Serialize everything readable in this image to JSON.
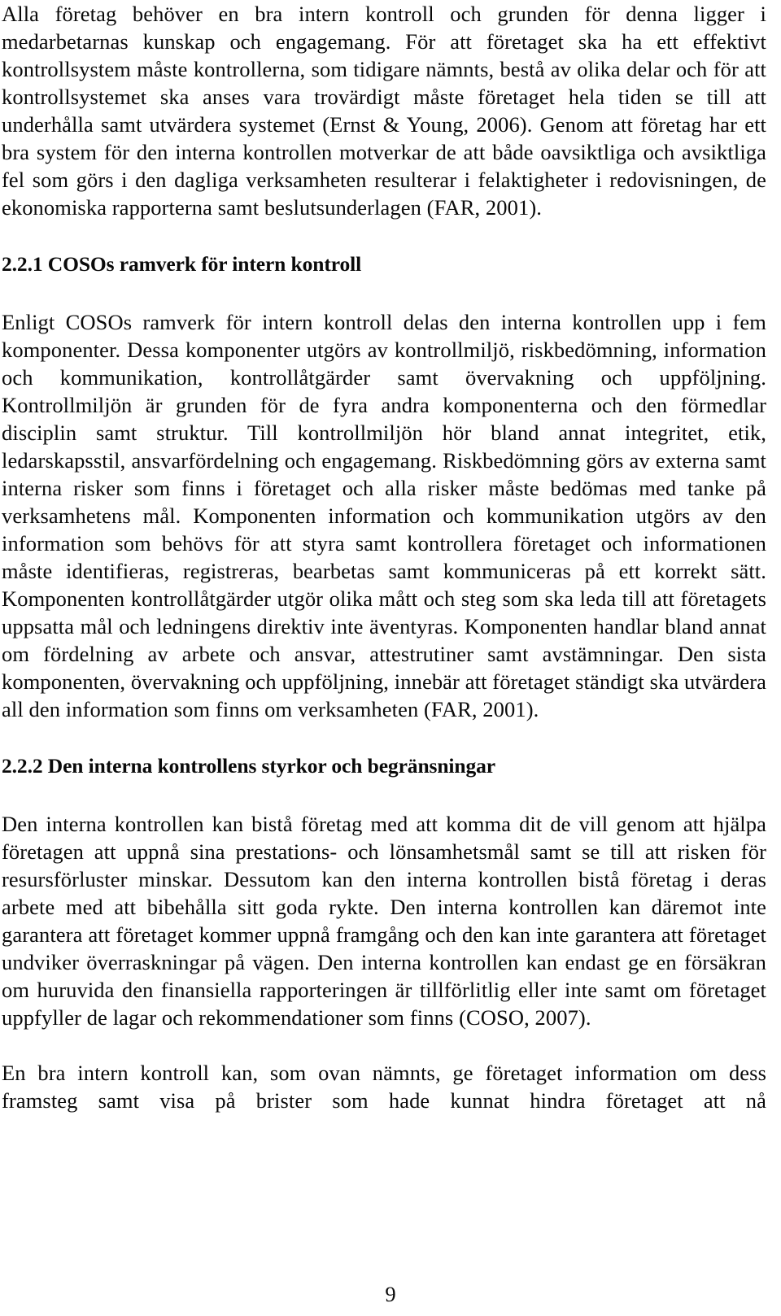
{
  "document": {
    "page_number": "9",
    "language": "sv",
    "blocks": [
      {
        "type": "paragraph",
        "name": "paragraph-intro-internal-control",
        "text": "Alla företag behöver en bra intern kontroll och grunden för denna ligger i medarbetarnas kunskap och engagemang. För att företaget ska ha ett effektivt kontrollsystem måste kontrollerna, som tidigare nämnts, bestå av olika delar och för att kontrollsystemet ska anses vara trovärdigt måste företaget hela tiden se till att underhålla samt utvärdera systemet (Ernst & Young, 2006). Genom att företag har ett bra system för den interna kontrollen motverkar de att både oavsiktliga och avsiktliga fel som görs i den dagliga verksamheten resulterar i felaktigheter i redovisningen, de ekonomiska rapporterna samt beslutsunderlagen (FAR, 2001)."
      },
      {
        "type": "heading",
        "name": "heading-2-2-1",
        "number": "2.2.1",
        "title": "COSOs ramverk för intern kontroll",
        "text": "2.2.1 COSOs ramverk för intern kontroll"
      },
      {
        "type": "paragraph",
        "name": "paragraph-coso-five-components",
        "text": "Enligt COSOs ramverk för intern kontroll delas den interna kontrollen upp i fem komponenter. Dessa komponenter utgörs av kontrollmiljö, riskbedömning, information och kommunikation, kontrollåtgärder samt övervakning och uppföljning. Kontrollmiljön är grunden för de fyra andra komponenterna och den förmedlar disciplin samt struktur. Till kontrollmiljön hör bland annat integritet, etik, ledarskapsstil, ansvarfördelning och engagemang. Riskbedömning görs av externa samt interna risker som finns i företaget och alla risker måste bedömas med tanke på verksamhetens mål. Komponenten information och kommunikation utgörs av den information som behövs för att styra samt kontrollera företaget och informationen måste identifieras, registreras, bearbetas samt kommuniceras på ett korrekt sätt. Komponenten kontrollåtgärder utgör olika mått och steg som ska leda till att företagets uppsatta mål och ledningens direktiv inte äventyras. Komponenten handlar bland annat om fördelning av arbete och ansvar, attestrutiner samt avstämningar. Den sista komponenten, övervakning och uppföljning, innebär att företaget ständigt ska utvärdera all den information som finns om verksamheten (FAR, 2001)."
      },
      {
        "type": "heading",
        "name": "heading-2-2-2",
        "number": "2.2.2",
        "title": "Den interna kontrollens styrkor och begränsningar",
        "text": "2.2.2 Den interna kontrollens styrkor och begränsningar"
      },
      {
        "type": "paragraph",
        "name": "paragraph-strengths-limitations",
        "text": "Den interna kontrollen kan bistå företag med att komma dit de vill genom att hjälpa företagen att uppnå sina prestations- och lönsamhetsmål samt se till att risken för resursförluster minskar. Dessutom kan den interna kontrollen bistå företag i deras arbete med att bibehålla sitt goda rykte. Den interna kontrollen kan däremot inte garantera att företaget kommer uppnå framgång och den kan inte garantera att företaget undviker överraskningar på vägen. Den interna kontrollen kan endast ge en försäkran om huruvida den finansiella rapporteringen är tillförlitlig eller inte samt om företaget uppfyller de lagar och rekommendationer som finns (COSO, 2007)."
      },
      {
        "type": "paragraph",
        "name": "paragraph-good-internal-control-info",
        "text": "En bra intern kontroll kan, som ovan nämnts, ge företaget information om dess framsteg samt visa på brister som hade kunnat hindra företaget att nå"
      }
    ],
    "citations": [
      "Ernst & Young, 2006",
      "FAR, 2001",
      "COSO, 2007"
    ]
  }
}
